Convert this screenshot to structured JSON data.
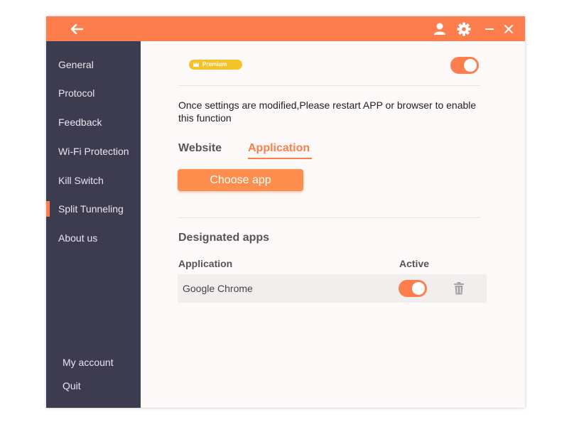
{
  "sidebar": {
    "items": [
      {
        "label": "General"
      },
      {
        "label": "Protocol"
      },
      {
        "label": "Feedback"
      },
      {
        "label": "Wi-Fi Protection"
      },
      {
        "label": "Kill Switch"
      },
      {
        "label": "Split Tunneling",
        "active": true
      },
      {
        "label": "About us"
      }
    ],
    "bottom": [
      {
        "label": "My account"
      },
      {
        "label": "Quit"
      }
    ]
  },
  "titlebar": {
    "icons": [
      "back-arrow-icon",
      "user-icon",
      "gear-icon",
      "minimize-icon",
      "close-icon"
    ]
  },
  "premium": {
    "badge": "Premium",
    "toggle_on": true
  },
  "notice": "Once settings are modified,Please restart APP or browser to enable this function",
  "tabs": [
    {
      "label": "Website",
      "active": false
    },
    {
      "label": "Application",
      "active": true
    }
  ],
  "choose_button": "Choose app",
  "designated": {
    "title": "Designated apps",
    "columns": {
      "application": "Application",
      "active": "Active"
    },
    "rows": [
      {
        "name": "Google Chrome",
        "active": true,
        "icon": "trash-icon"
      }
    ]
  },
  "colors": {
    "accent": "#fd7e4c",
    "sidebar": "#3d3b4f",
    "premium": "#f5c22b"
  }
}
